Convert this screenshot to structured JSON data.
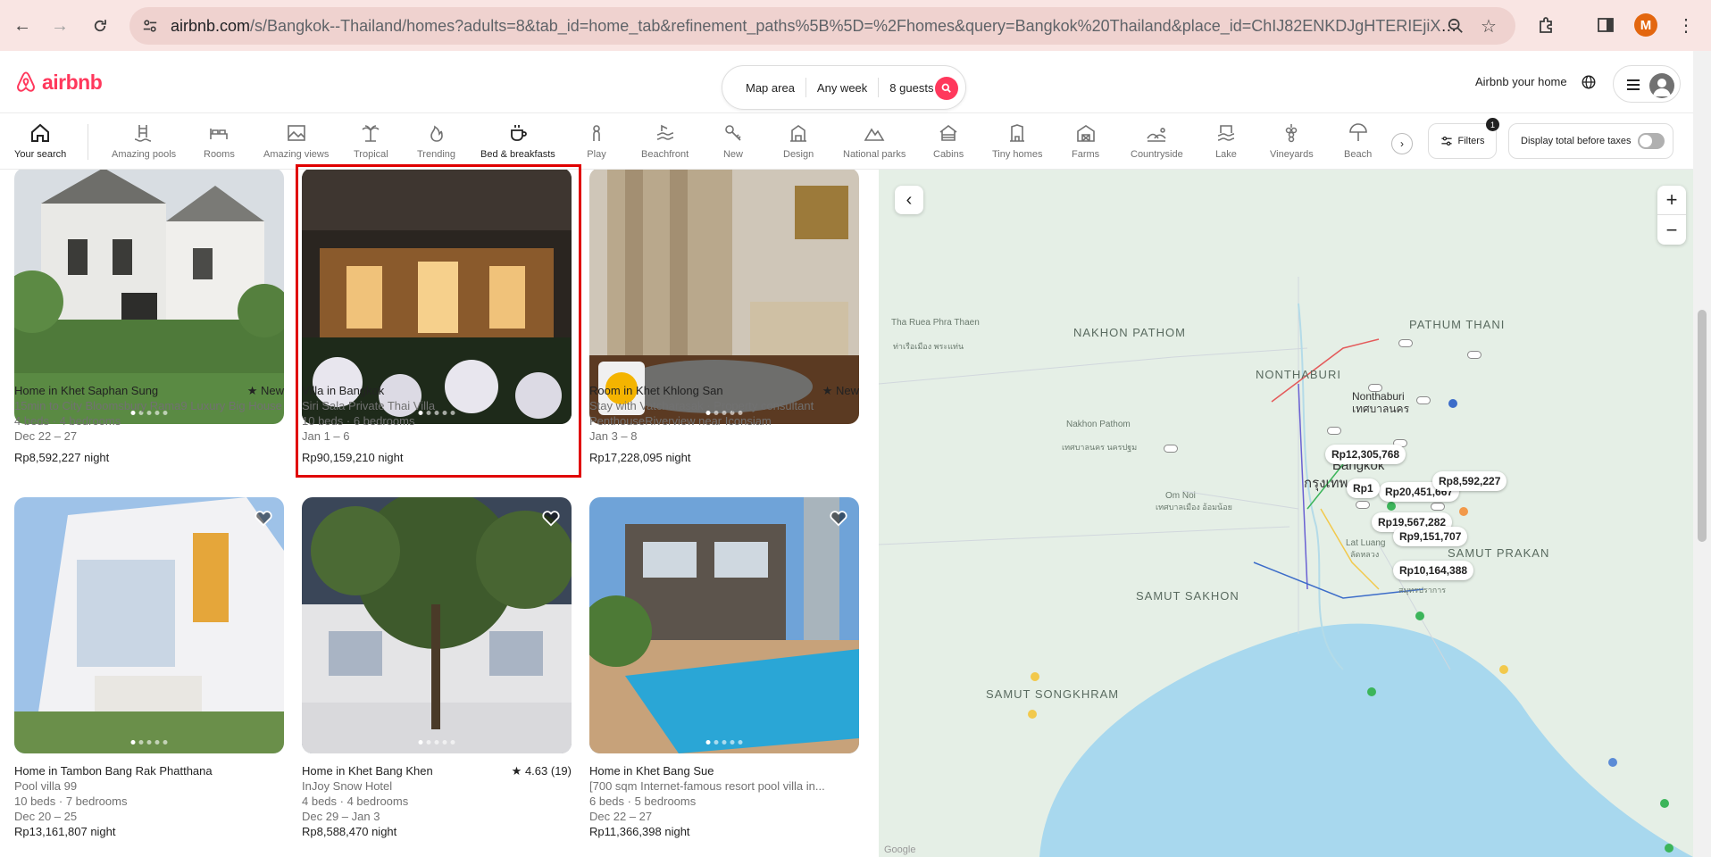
{
  "browser": {
    "url_host": "airbnb.com",
    "url_rest": "/s/Bangkok--Thailand/homes?adults=8&tab_id=home_tab&refinement_paths%5B%5D=%2Fhomes&query=Bangkok%20Thailand&place_id=ChIJ82ENKDJgHTERIEjiXbIAA...",
    "profile_initial": "M"
  },
  "header": {
    "logo_text": "airbnb",
    "search": {
      "where": "Map area",
      "when": "Any week",
      "who": "8 guests"
    },
    "host_link": "Airbnb your home"
  },
  "categories": [
    {
      "label": "Your search",
      "icon": "home-icon"
    },
    {
      "label": "Amazing pools",
      "icon": "pool-icon"
    },
    {
      "label": "Rooms",
      "icon": "bed-icon"
    },
    {
      "label": "Amazing views",
      "icon": "picture-icon"
    },
    {
      "label": "Tropical",
      "icon": "palm-icon"
    },
    {
      "label": "Trending",
      "icon": "flame-icon"
    },
    {
      "label": "Bed & breakfasts",
      "icon": "coffee-icon"
    },
    {
      "label": "Play",
      "icon": "play-icon"
    },
    {
      "label": "Beachfront",
      "icon": "wave-icon"
    },
    {
      "label": "New",
      "icon": "key-icon"
    },
    {
      "label": "Design",
      "icon": "building-icon"
    },
    {
      "label": "National parks",
      "icon": "mountain-icon"
    },
    {
      "label": "Cabins",
      "icon": "cabin-icon"
    },
    {
      "label": "Tiny homes",
      "icon": "tiny-home-icon"
    },
    {
      "label": "Farms",
      "icon": "barn-icon"
    },
    {
      "label": "Countryside",
      "icon": "hills-icon"
    },
    {
      "label": "Lake",
      "icon": "lake-icon"
    },
    {
      "label": "Vineyards",
      "icon": "grapes-icon"
    },
    {
      "label": "Beach",
      "icon": "umbrella-icon"
    }
  ],
  "filters": {
    "label": "Filters",
    "count": "1",
    "taxes_label": "Display total before taxes"
  },
  "listings": [
    {
      "title": "Home in Khet Saphan Sung",
      "rating": "New",
      "desc": "15min to City Bloomsbury Rama9 Luxury Big House",
      "desc2": "4 beds · 4 bedrooms",
      "dates": "Dec 22 – 27",
      "price": "Rp8,592,227",
      "unit": "night"
    },
    {
      "title": "Villa in Bangkok",
      "rating": "",
      "desc": "Siri Sala Private Thai Villa",
      "desc2": "10 beds · 6 bedrooms",
      "dates": "Jan 1 – 6",
      "price": "Rp90,159,210",
      "unit": "night"
    },
    {
      "title": "Room in Khet Khlong San",
      "rating": "New",
      "desc": "Stay with Vatcharasak · Property consultant",
      "desc2": "PenthouseRiverview near Iconsiam",
      "dates": "Jan 3 – 8",
      "price": "Rp17,228,095",
      "unit": "night"
    },
    {
      "title": "Home in Tambon Bang Rak Phatthana",
      "rating": "",
      "desc": "Pool villa 99",
      "desc2": "10 beds · 7 bedrooms",
      "dates": "Dec 20 – 25",
      "price": "Rp13,161,807",
      "unit": "night"
    },
    {
      "title": "Home in Khet Bang Khen",
      "rating": "4.63 (19)",
      "desc": "InJoy Snow Hotel",
      "desc2": "4 beds · 4 bedrooms",
      "dates": "Dec 29 – Jan 3",
      "price": "Rp8,588,470",
      "unit": "night"
    },
    {
      "title": "Home in Khet Bang Sue",
      "rating": "",
      "desc": "[700 sqm Internet-famous resort pool villa in...",
      "desc2": "6 beds · 5 bedrooms",
      "dates": "Dec 22 – 27",
      "price": "Rp11,366,398",
      "unit": "night"
    }
  ],
  "map": {
    "regions": [
      "NAKHON PATHOM",
      "PATHUM THANI",
      "NONTHABURI",
      "SAMUT SAKHON",
      "SAMUT PRAKAN",
      "SAMUT SONGKHRAM"
    ],
    "places": [
      "Tha Ruea Phra Thaen",
      "ท่าเรือเมือง พระแท่น",
      "Nakhon Pathom",
      "เทศบาลนคร นครปฐม",
      "Om Noi",
      "เทศบาลเมือง อ้อมน้อย",
      "Lat Luang",
      "ลัดหลวง",
      "สมุทรปราการ",
      "Nonthaburi",
      "เทศบาลนคร",
      "Bangkok",
      "กรุงเทพ"
    ],
    "prices": [
      "Rp12,305,768",
      "Rp20,451,667",
      "Rp8,592,227",
      "Rp19,567,282",
      "Rp9,151,707",
      "Rp10,164,388",
      "Rp1"
    ],
    "attribution": "Google"
  }
}
